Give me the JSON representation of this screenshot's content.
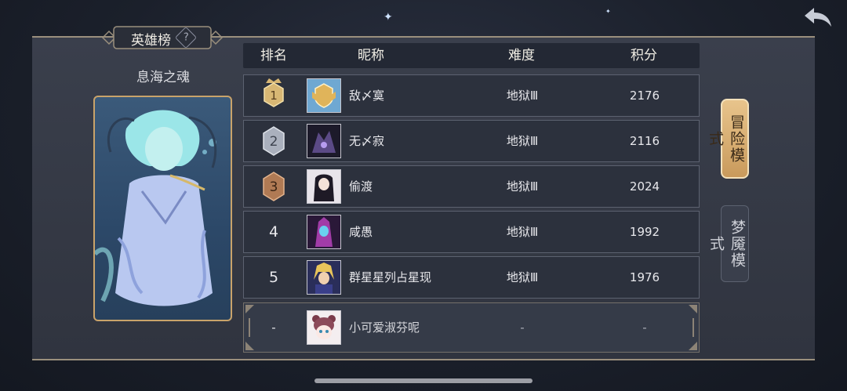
{
  "header": {
    "title": "英雄榜",
    "help": "?"
  },
  "hero": {
    "name": "息海之魂"
  },
  "table": {
    "columns": [
      "排名",
      "昵称",
      "难度",
      "积分"
    ],
    "rows": [
      {
        "rank": "1",
        "nickname": "敌〆寞",
        "difficulty": "地狱Ⅲ",
        "score": "2176"
      },
      {
        "rank": "2",
        "nickname": "无〆寂",
        "difficulty": "地狱Ⅲ",
        "score": "2116"
      },
      {
        "rank": "3",
        "nickname": "偷渡",
        "difficulty": "地狱Ⅲ",
        "score": "2024"
      },
      {
        "rank": "4",
        "nickname": "咸愚",
        "difficulty": "地狱Ⅲ",
        "score": "1992"
      },
      {
        "rank": "5",
        "nickname": "群星星列占星现",
        "difficulty": "地狱Ⅲ",
        "score": "1976"
      }
    ],
    "self": {
      "rank": "-",
      "nickname": "小可爱淑芬呢",
      "difficulty": "-",
      "score": "-"
    }
  },
  "modes": {
    "active": "冒险模式",
    "inactive": "梦魇模式"
  },
  "colors": {
    "gold": "#d8b774",
    "silver": "#aab0bd",
    "bronze": "#b07a54",
    "accent": "#c99a5c"
  }
}
